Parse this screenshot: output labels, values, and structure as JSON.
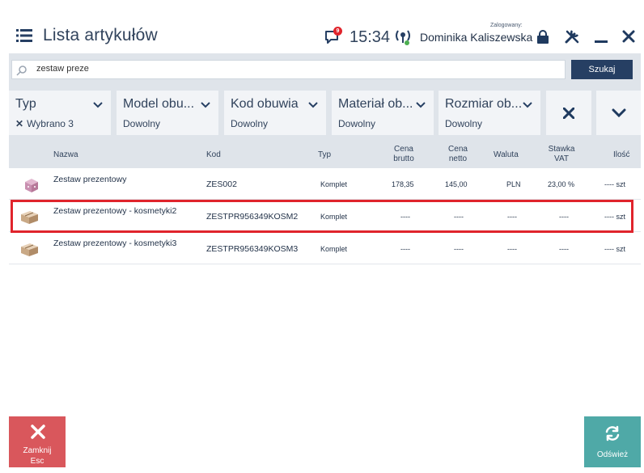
{
  "header": {
    "title": "Lista artykułów",
    "notification_count": "9",
    "time": "15:34",
    "logged_label": "Zalogowany:",
    "user": "Dominika Kaliszewska"
  },
  "search": {
    "value": "zestaw preze",
    "button_label": "Szukaj"
  },
  "filters": [
    {
      "label": "Typ",
      "value": "Wybrano 3",
      "cleared": true
    },
    {
      "label": "Model obu...",
      "value": "Dowolny"
    },
    {
      "label": "Kod obuwia",
      "value": "Dowolny"
    },
    {
      "label": "Materiał ob...",
      "value": "Dowolny"
    },
    {
      "label": "Rozmiar ob...",
      "value": "Dowolny"
    }
  ],
  "table": {
    "headers": {
      "name": "Nazwa",
      "code": "Kod",
      "type": "Typ",
      "gross_1": "Cena",
      "gross_2": "brutto",
      "net_1": "Cena",
      "net_2": "netto",
      "currency": "Waluta",
      "vat_1": "Stawka",
      "vat_2": "VAT",
      "qty": "Ilość"
    },
    "rows": [
      {
        "icon": "gift-box-icon",
        "name": "Zestaw prezentowy",
        "code": "ZES002",
        "type": "Komplet",
        "gross": "178,35",
        "net": "145,00",
        "currency": "PLN",
        "vat": "23,00 %",
        "qty": "---- szt"
      },
      {
        "icon": "parcel-icon",
        "name": "Zestaw prezentowy - kosmetyki2",
        "code": "ZESTPR956349KOSM2",
        "type": "Komplet",
        "gross": "----",
        "net": "----",
        "currency": "----",
        "vat": "----",
        "qty": "---- szt"
      },
      {
        "icon": "parcel-icon",
        "name": "Zestaw prezentowy - kosmetyki3",
        "code": "ZESTPR956349KOSM3",
        "type": "Komplet",
        "gross": "----",
        "net": "----",
        "currency": "----",
        "vat": "----",
        "qty": "---- szt"
      }
    ]
  },
  "footer": {
    "close_label_1": "Zamknij",
    "close_label_2": "Esc",
    "refresh_label": "Odśwież"
  },
  "colors": {
    "accent": "#263f63",
    "close_button": "#d9575c",
    "refresh_button": "#4fa9a7",
    "selection_border": "#e0242c",
    "panel_bg": "#dfe4ea"
  }
}
